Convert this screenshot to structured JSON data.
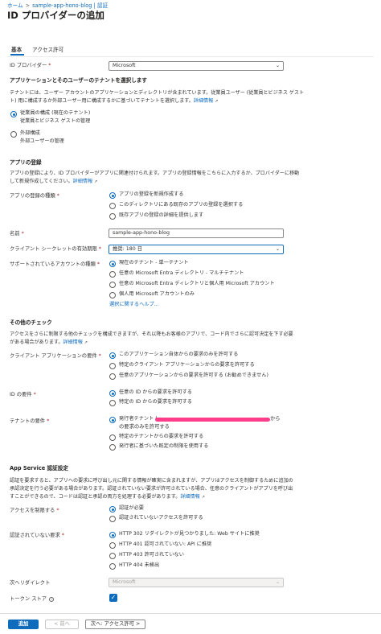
{
  "breadcrumb": [
    "ホーム",
    "sample-app-hono-blog | 認証"
  ],
  "page_title": "ID プロバイダーの追加",
  "tabs": [
    {
      "label": "基本",
      "active": true
    },
    {
      "label": "アクセス許可",
      "active": false
    }
  ],
  "identity_provider": {
    "label": "ID プロバイダー",
    "required": "*",
    "value": "Microsoft"
  },
  "tenant_section": {
    "heading": "アプリケーションとそのユーザーのテナントを選択します",
    "desc_line1": "テナントには、ユーザー アカウントのアプリケーションとディレクトリが含まれています。従業員ユーザー (従業員とビジネス ゲスト",
    "desc_line2": "ト) 用に構成するか外部ユーザー用に構成するかに基づいてテナントを選択します。",
    "link": "詳細情報",
    "options": [
      {
        "title": "従業員の構成 (現在のテナント)",
        "subtitle": "従業員とビジネス ゲストの管理",
        "checked": true
      },
      {
        "title": "外部構成",
        "subtitle": "外部ユーザーの管理",
        "checked": false
      }
    ]
  },
  "app_registration": {
    "heading": "アプリの登録",
    "desc_line1": "アプリの登録により、ID プロバイダーがアプリに関連付けられます。アプリの登録情報をこちらに入力するか、プロバイダーに移動",
    "desc_line2": "して新規作成してください。",
    "link": "詳細情報",
    "type_label": "アプリの登録の種類",
    "required": "*",
    "type_options": [
      {
        "label": "アプリの登録を新規作成する",
        "checked": true
      },
      {
        "label": "このディレクトリにある既存のアプリの登録を選択する",
        "checked": false
      },
      {
        "label": "既存アプリの登録の詳細を提供します",
        "checked": false
      }
    ],
    "name_label": "名前",
    "name_value": "sample-app-hono-blog",
    "secret_label": "クライアント シークレットの有効期限",
    "secret_value": "推奨: 180 日",
    "accounts_label": "サポートされているアカウントの種類",
    "accounts_options": [
      {
        "label": "現在のテナント - 単一テナント",
        "checked": true
      },
      {
        "label": "任意の Microsoft Entra ディレクトリ - マルチテナント",
        "checked": false
      },
      {
        "label": "任意の Microsoft Entra ディレクトリと個人用 Microsoft アカウント",
        "checked": false
      },
      {
        "label": "個人用 Microsoft アカウントのみ",
        "checked": false
      }
    ],
    "help_link": "選択に関するヘルプ..."
  },
  "other_checks": {
    "heading": "その他のチェック",
    "desc_line1": "アクセスをさらに制限する他のチェックを構成できますが、それ以降もお客様のアプリで、コード内でさらに認可決定を下す必要",
    "desc_line2": "がある場合があります。",
    "link": "詳細情報",
    "client_label": "クライアント アプリケーションの要件",
    "client_options": [
      {
        "label": "このアプリケーション自体からの要求のみを許可する",
        "checked": true
      },
      {
        "label": "特定のクライアント アプリケーションからの要求を許可する",
        "checked": false
      },
      {
        "label": "任意のアプリケーションからの要求を許可する (お勧めできません)",
        "checked": false
      }
    ],
    "identity_label": "ID の要件",
    "identity_options": [
      {
        "label": "任意の ID からの要求を許可する",
        "checked": true
      },
      {
        "label": "特定の ID からの要求を許可する",
        "checked": false
      }
    ],
    "tenant_label": "テナントの要件",
    "tenant_options": [
      {
        "label": "発行者テナント (",
        "label_tail": "から",
        "label_line2": "の要求のみを許可する",
        "checked": true
      },
      {
        "label": "特定のテナントからの要求を許可する",
        "checked": false
      },
      {
        "label": "発行者に基づいた既定の制限を使用する",
        "checked": false
      }
    ]
  },
  "app_service_auth": {
    "heading": "App Service 認証設定",
    "desc_line1": "認証を要求すると、アプリへの要求に呼び出し元に関する情報が確実に含まれますが、アプリはアクセスを制御するために追加の",
    "desc_line2": "承認決定を行う必要がある場合があります。認証されていない要求が許可されている場合、任意のクライアントがアプリを呼び出",
    "desc_line3": "すことができるので、コードは認証と承認の両方を処理する必要があります。",
    "link": "詳細情報",
    "restrict_label": "アクセスを制限する",
    "restrict_options": [
      {
        "label": "認証が必要",
        "checked": true
      },
      {
        "label": "認証されていないアクセスを許可する",
        "checked": false
      }
    ],
    "unauth_label": "認証されていない要求",
    "unauth_options": [
      {
        "label": "HTTP 302 リダイレクトが見つかりました: Web サイトに推奨",
        "checked": true
      },
      {
        "label": "HTTP 401 認可されていない: API に推奨",
        "checked": false
      },
      {
        "label": "HTTP 403 許可されていない",
        "checked": false
      },
      {
        "label": "HTTP 404 未検出",
        "checked": false
      }
    ],
    "redirect_label": "次へリダイレクト",
    "redirect_value": "Microsoft",
    "token_store_label": "トークン ストア",
    "token_store_checked": true
  },
  "footer": {
    "add_label": "追加",
    "prev_label": "< 前へ",
    "next_label": "次へ: アクセス許可 >"
  },
  "colors": {
    "accent": "#0f6cbd",
    "required": "#a4262c",
    "redaction": "#ff3d8a"
  }
}
